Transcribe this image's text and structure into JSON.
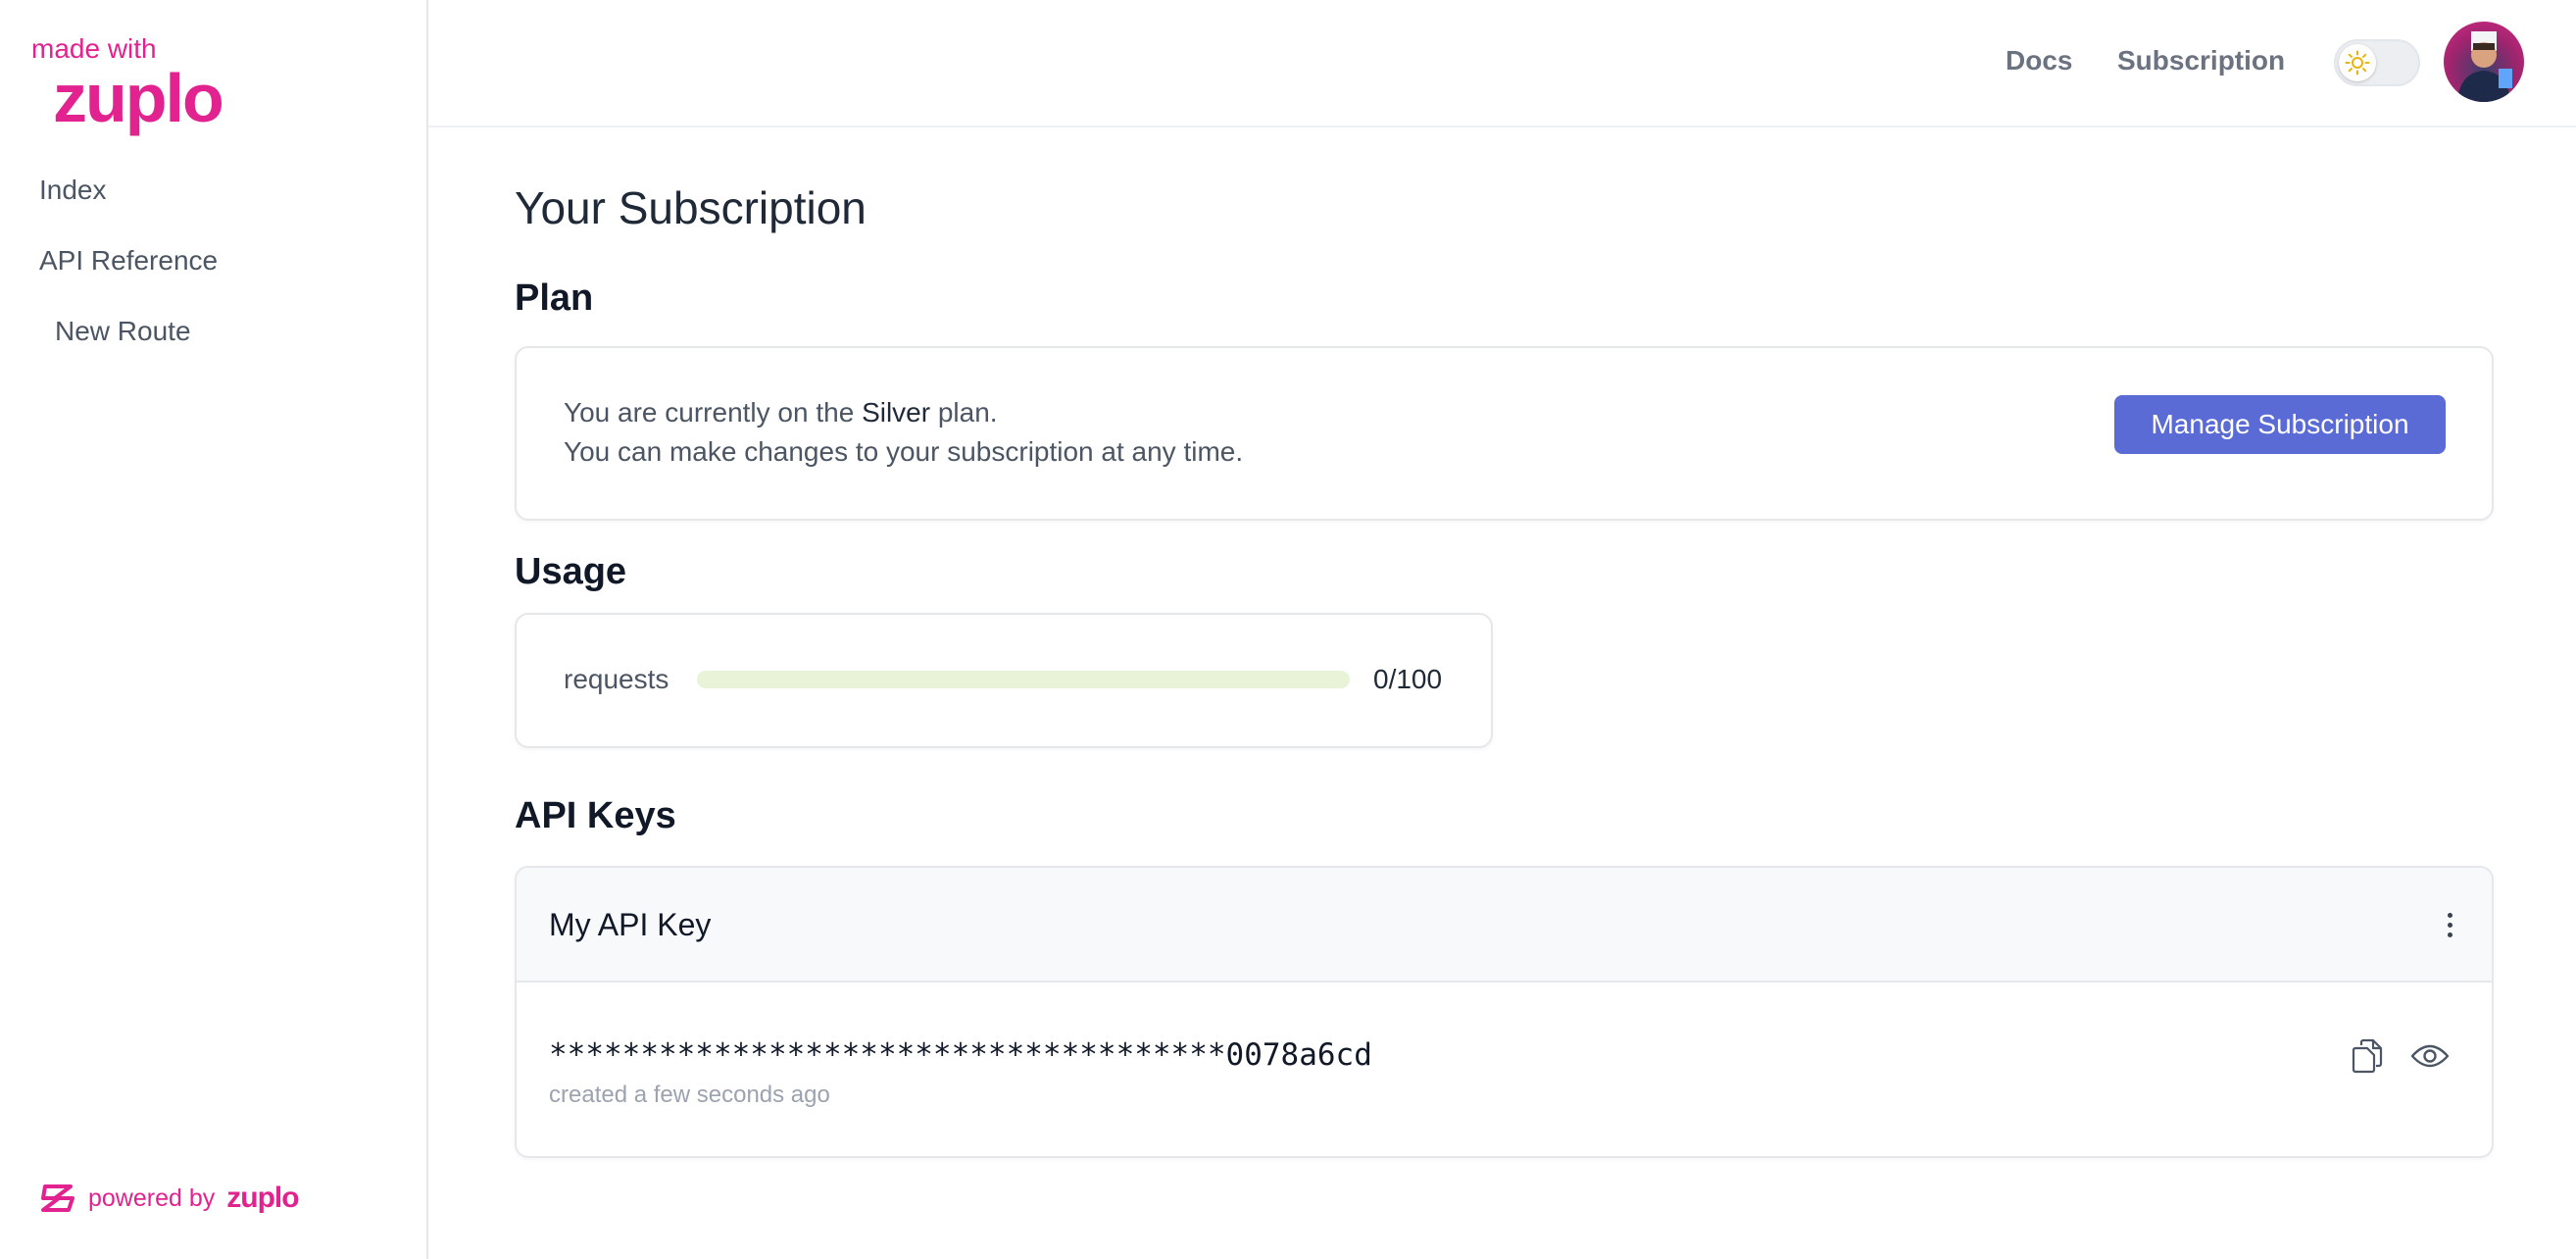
{
  "brand": {
    "top": "made with",
    "main": "zuplo"
  },
  "sidebar": {
    "items": [
      {
        "label": "Index"
      },
      {
        "label": "API Reference"
      },
      {
        "label": "New Route"
      }
    ],
    "powered_by": "powered by",
    "powered_brand": "zuplo"
  },
  "header": {
    "links": [
      {
        "label": "Docs"
      },
      {
        "label": "Subscription"
      }
    ],
    "theme_toggle_icon": "sun-icon"
  },
  "main": {
    "title": "Your Subscription",
    "plan": {
      "heading": "Plan",
      "line1_prefix": "You are currently on the ",
      "plan_name": "Silver",
      "line1_suffix": " plan.",
      "line2": "You can make changes to your subscription at any time.",
      "manage_label": "Manage Subscription"
    },
    "usage": {
      "heading": "Usage",
      "label": "requests",
      "value_text": "0/100",
      "used": 0,
      "limit": 100
    },
    "api_keys": {
      "heading": "API Keys",
      "keys": [
        {
          "name": "My API Key",
          "masked_value": "*************************************0078a6cd",
          "created": "created a few seconds ago"
        }
      ]
    }
  },
  "colors": {
    "brand": "#e2238f",
    "button": "#5b6bd6",
    "usage_track": "#e8f3d8"
  }
}
